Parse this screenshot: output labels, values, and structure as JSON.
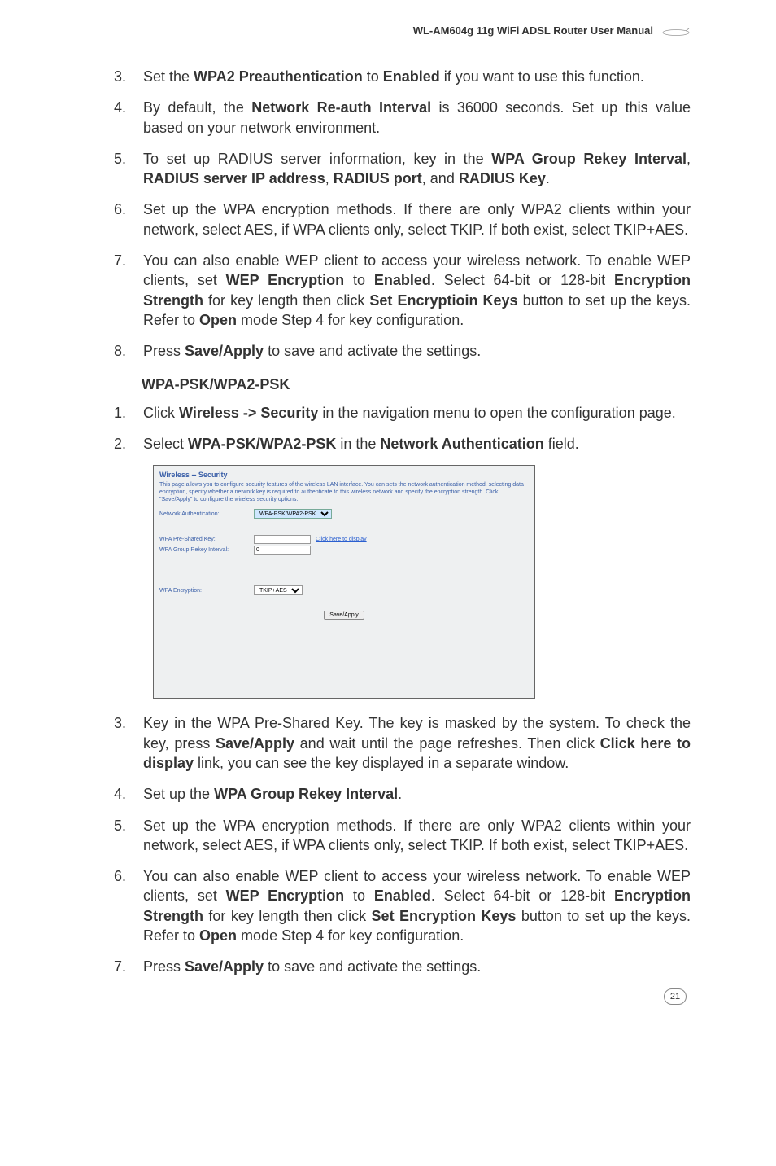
{
  "header": {
    "title": "WL-AM604g 11g WiFi ADSL Router User Manual"
  },
  "top_list": [
    {
      "num": "3.",
      "parts": [
        "Set the ",
        "WPA2 Preauthentication",
        " to ",
        "Enabled",
        " if you want to use this function."
      ]
    },
    {
      "num": "4.",
      "parts": [
        "By default, the ",
        "Network Re-auth Interval",
        " is 36000 seconds. Set up this value based on your network environment."
      ]
    },
    {
      "num": "5.",
      "parts": [
        "To set up RADIUS server information, key in the ",
        "WPA Group Rekey Interval",
        ", ",
        "RADIUS server IP address",
        ", ",
        "RADIUS port",
        ", and ",
        "RADIUS Key",
        "."
      ]
    },
    {
      "num": "6.",
      "parts": [
        "Set up the WPA encryption methods. If there are only WPA2 clients within your network, select AES, if WPA clients only, select TKIP. If both exist, select TKIP+AES."
      ]
    },
    {
      "num": "7.",
      "parts": [
        "You can also enable WEP client to access your wireless network. To enable WEP clients, set ",
        "WEP Encryption",
        " to ",
        "Enabled",
        ". Select 64-bit or 128-bit ",
        "Encryption Strength",
        " for key length then click ",
        "Set Encryptioin Keys",
        " button to set up the keys. Refer to ",
        "Open",
        " mode Step 4 for key configuration."
      ]
    },
    {
      "num": "8.",
      "parts": [
        "Press ",
        "Save/Apply",
        " to save and activate the settings."
      ]
    }
  ],
  "section_heading": "WPA-PSK/WPA2-PSK",
  "mid_list": [
    {
      "num": "1.",
      "parts": [
        "Click ",
        "Wireless -> Security",
        " in the navigation menu to open the configuration page."
      ]
    },
    {
      "num": "2.",
      "parts": [
        "Select ",
        "WPA-PSK/WPA2-PSK",
        " in the ",
        "Network Authentication",
        " field."
      ]
    }
  ],
  "screenshot": {
    "title": "Wireless -- Security",
    "description": "This page allows you to configure security features of the wireless LAN interface. You can sets the network authentication method, selecting data encryption, specify whether a network key is required to authenticate to this wireless network and specify the encryption strength. Click \"Save/Apply\" to configure the wireless security options.",
    "rows": {
      "net_auth_label": "Network Authentication:",
      "net_auth_value": "WPA-PSK/WPA2-PSK",
      "psk_label": "WPA Pre-Shared Key:",
      "psk_value": "",
      "psk_link": "Click here to display",
      "rekey_label": "WPA Group Rekey Interval:",
      "rekey_value": "0",
      "enc_label": "WPA Encryption:",
      "enc_value": "TKIP+AES"
    },
    "button": "Save/Apply"
  },
  "bottom_list": [
    {
      "num": "3.",
      "parts": [
        "Key in the WPA Pre-Shared Key. The key is masked by the system. To check the key, press ",
        "Save/Apply",
        " and wait until the page refreshes. Then click ",
        "Click here to display",
        " link, you can see the key displayed in a separate window."
      ]
    },
    {
      "num": "4.",
      "parts": [
        "Set up the ",
        "WPA Group Rekey Interval",
        "."
      ]
    },
    {
      "num": "5.",
      "parts": [
        "Set up the WPA encryption methods. If there are only WPA2 clients within your network, select AES, if WPA clients only, select TKIP. If both exist, select TKIP+AES."
      ]
    },
    {
      "num": "6.",
      "parts": [
        "You can also enable WEP client to access your wireless network. To enable WEP clients, set ",
        "WEP Encryption",
        " to ",
        "Enabled",
        ". Select 64-bit or 128-bit ",
        "Encryption Strength",
        " for key length then click ",
        "Set Encryption Keys",
        " button to set up the keys. Refer to ",
        "Open",
        " mode Step 4 for key configuration."
      ]
    },
    {
      "num": "7.",
      "parts": [
        "Press ",
        "Save/Apply",
        " to save and activate the settings."
      ]
    }
  ],
  "page_number": "21"
}
